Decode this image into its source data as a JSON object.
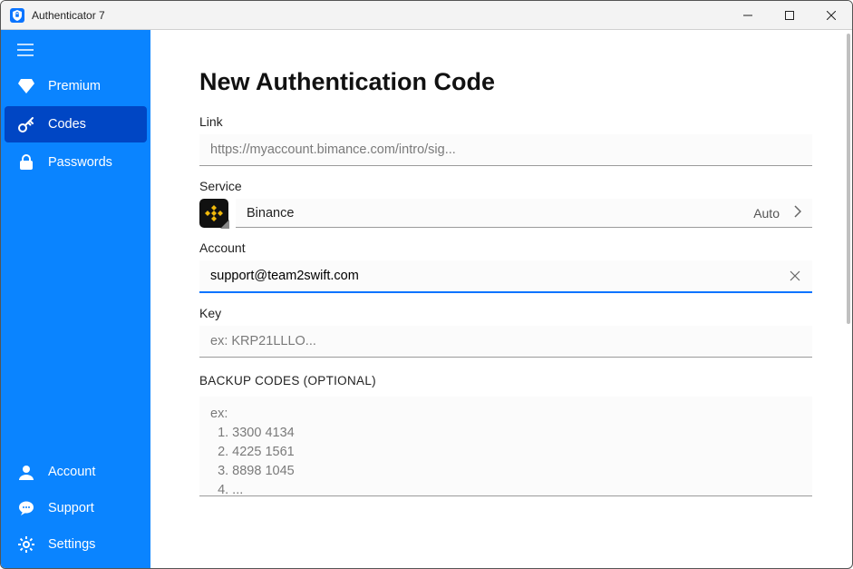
{
  "window": {
    "title": "Authenticator 7"
  },
  "sidebar": {
    "items": [
      {
        "key": "premium",
        "label": "Premium",
        "selected": false
      },
      {
        "key": "codes",
        "label": "Codes",
        "selected": true
      },
      {
        "key": "passwords",
        "label": "Passwords",
        "selected": false
      }
    ],
    "bottom_items": [
      {
        "key": "account",
        "label": "Account"
      },
      {
        "key": "support",
        "label": "Support"
      },
      {
        "key": "settings",
        "label": "Settings"
      }
    ]
  },
  "main": {
    "title": "New Authentication Code",
    "fields": {
      "link": {
        "label": "Link",
        "value": "https://myaccount.bimance.com/intro/sig..."
      },
      "service": {
        "label": "Service",
        "name": "Binance",
        "mode": "Auto",
        "icon": "binance-icon"
      },
      "account": {
        "label": "Account",
        "value": "support@team2swift.com",
        "focused": true
      },
      "key": {
        "label": "Key",
        "placeholder": "ex: KRP21LLLO..."
      },
      "backup_codes": {
        "label": "BACKUP CODES (OPTIONAL)",
        "placeholder": "ex:\n  1. 3300 4134\n  2. 4225 1561\n  3. 8898 1045\n  4. ..."
      }
    }
  }
}
